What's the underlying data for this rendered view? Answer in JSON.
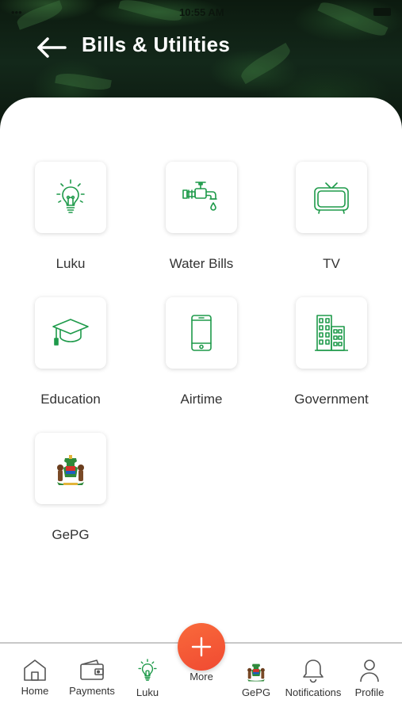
{
  "header": {
    "title": "Bills & Utilities",
    "back_icon": "arrow-left-icon"
  },
  "status_bar": {
    "time": "10:55 AM"
  },
  "theme": {
    "accent_green": "#1e9a4a",
    "fab_orange": "#f35a36",
    "text": "#333333"
  },
  "services": [
    {
      "label": "Luku",
      "icon": "lightbulb-icon"
    },
    {
      "label": "Water Bills",
      "icon": "water-tap-icon"
    },
    {
      "label": "TV",
      "icon": "tv-icon"
    },
    {
      "label": "Education",
      "icon": "graduation-cap-icon"
    },
    {
      "label": "Airtime",
      "icon": "mobile-phone-icon"
    },
    {
      "label": "Government",
      "icon": "building-icon"
    },
    {
      "label": "GePG",
      "icon": "coat-of-arms-icon"
    }
  ],
  "bottom_nav": {
    "items": [
      {
        "label": "Home",
        "icon": "home-icon"
      },
      {
        "label": "Payments",
        "icon": "wallet-icon"
      },
      {
        "label": "Luku",
        "icon": "lightbulb-icon"
      },
      {
        "label": "GePG",
        "icon": "coat-of-arms-icon"
      },
      {
        "label": "Notifications",
        "icon": "bell-icon"
      },
      {
        "label": "Profile",
        "icon": "user-icon"
      }
    ],
    "fab_label": "More",
    "fab_icon": "plus-icon"
  }
}
